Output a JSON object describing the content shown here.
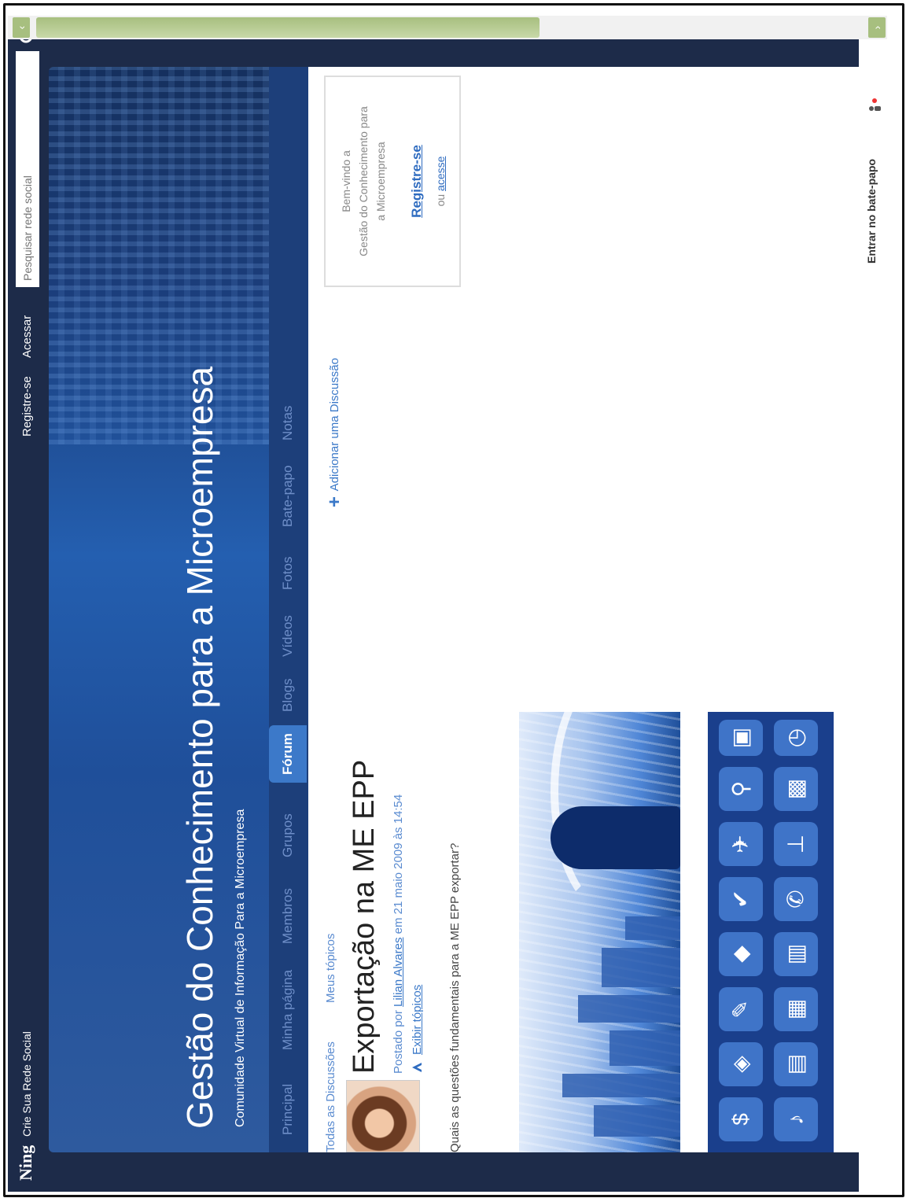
{
  "topbar": {
    "logo": "Ning",
    "create_network": "Crie Sua Rede Social",
    "register": "Registre-se",
    "login": "Acessar",
    "search_placeholder": "Pesquisar rede social"
  },
  "header": {
    "title": "Gestão do Conhecimento para a Microempresa",
    "subtitle": "Comunidade Virtual de Informação Para a Microempresa"
  },
  "nav": {
    "items": [
      {
        "label": "Principal"
      },
      {
        "label": "Minha página"
      },
      {
        "label": "Membros"
      },
      {
        "label": "Grupos"
      },
      {
        "label": "Fórum"
      },
      {
        "label": "Blogs"
      },
      {
        "label": "Vídeos"
      },
      {
        "label": "Fotos"
      },
      {
        "label": "Bate-papo"
      },
      {
        "label": "Notas"
      }
    ],
    "active": "Fórum"
  },
  "forum": {
    "tab_all": "Todas as Discussões",
    "tab_mine": "Meus tópicos",
    "add_discussion": "Adicionar uma Discussão",
    "post": {
      "title": "Exportação na ME EPP",
      "posted_by_prefix": "Postado por",
      "author": "Lilian Alvares",
      "date_text": "em 21 maio 2009 às 14:54",
      "view_topics": "Exibir tópicos",
      "question": "Quais as questões fundamentais para a ME EPP exportar?"
    }
  },
  "welcome": {
    "line1": "Bem-vindo a",
    "line2": "Gestão do Conhecimento para",
    "line3": "a Microempresa",
    "register": "Registre-se",
    "or": "ou",
    "login": "acesse"
  },
  "chat": {
    "label": "Entrar no bate-papo"
  },
  "colors": {
    "topbar": "#1d2b49",
    "header": "#1f4f9a",
    "nav_active": "#3c79c9",
    "link": "#3a78c8"
  }
}
